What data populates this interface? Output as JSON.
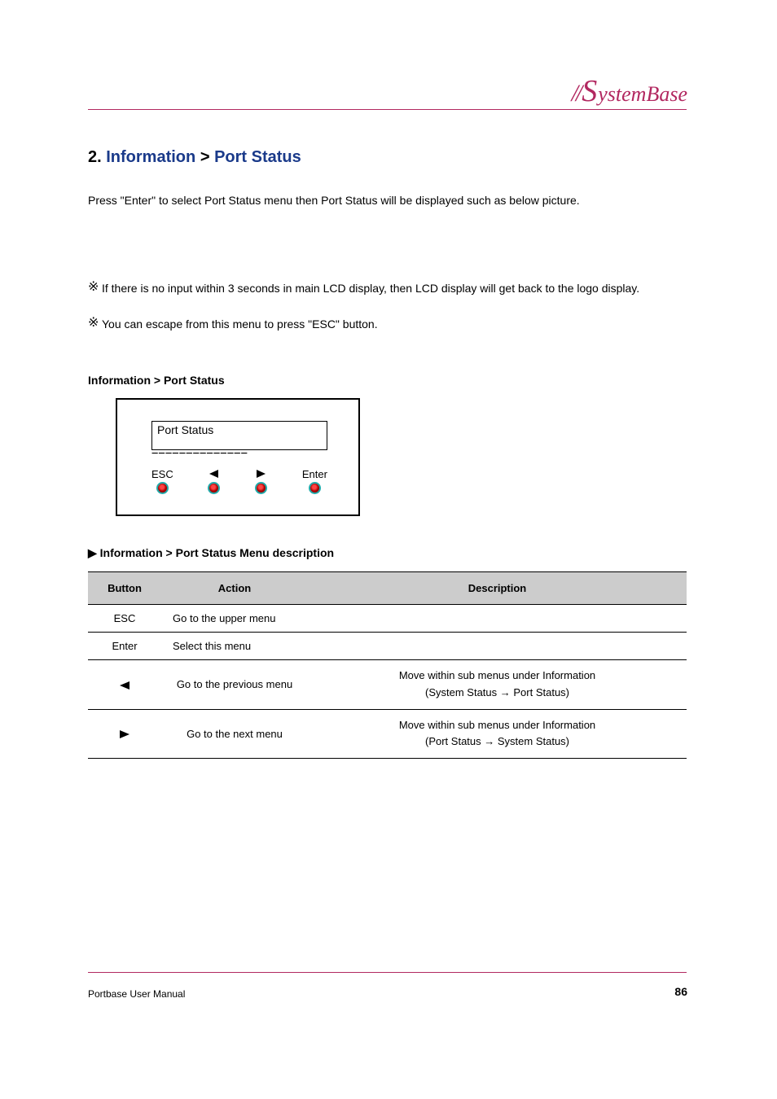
{
  "brand": {
    "prefix": "//",
    "s": "S",
    "rest": "ystemBase"
  },
  "section": {
    "main": "2.",
    "blue": "Information",
    "sub": ">",
    "sub_blue": "Port Status"
  },
  "paragraphs": {
    "p1": "Press \"Enter\" to select Port Status menu then Port Status will be displayed such as below picture.",
    "note1": "If there is no input within 3 seconds in main LCD display, then LCD display will get back to the logo display.",
    "note2": "You can escape from this menu to press \"ESC\" button."
  },
  "bullet": "※",
  "subtitle": "Information > Port Status",
  "lcd": {
    "title": "Port Status",
    "sep": "−−−−−−−−−−−−−−",
    "esc": "ESC",
    "enter": "Enter"
  },
  "table": {
    "title": "▶ Information > Port Status Menu description",
    "head": {
      "button": "Button",
      "action": "Action",
      "description": "Description"
    },
    "rows": [
      {
        "button": "ESC",
        "action": "Go to the upper menu",
        "description": "",
        "span": true
      },
      {
        "button": "Enter",
        "action": "Select this menu",
        "description": "",
        "span": true
      },
      {
        "button": "left",
        "action": "Go to the previous menu",
        "desc1": "Move within sub menus under Information",
        "desc2": "(System Status → Port Status)"
      },
      {
        "button": "right",
        "action": "Go to the next menu",
        "desc1": "Move within sub menus under Information",
        "desc2": "(Port Status → System Status)"
      }
    ]
  },
  "footer": {
    "left": "Portbase User Manual",
    "right": "86"
  }
}
